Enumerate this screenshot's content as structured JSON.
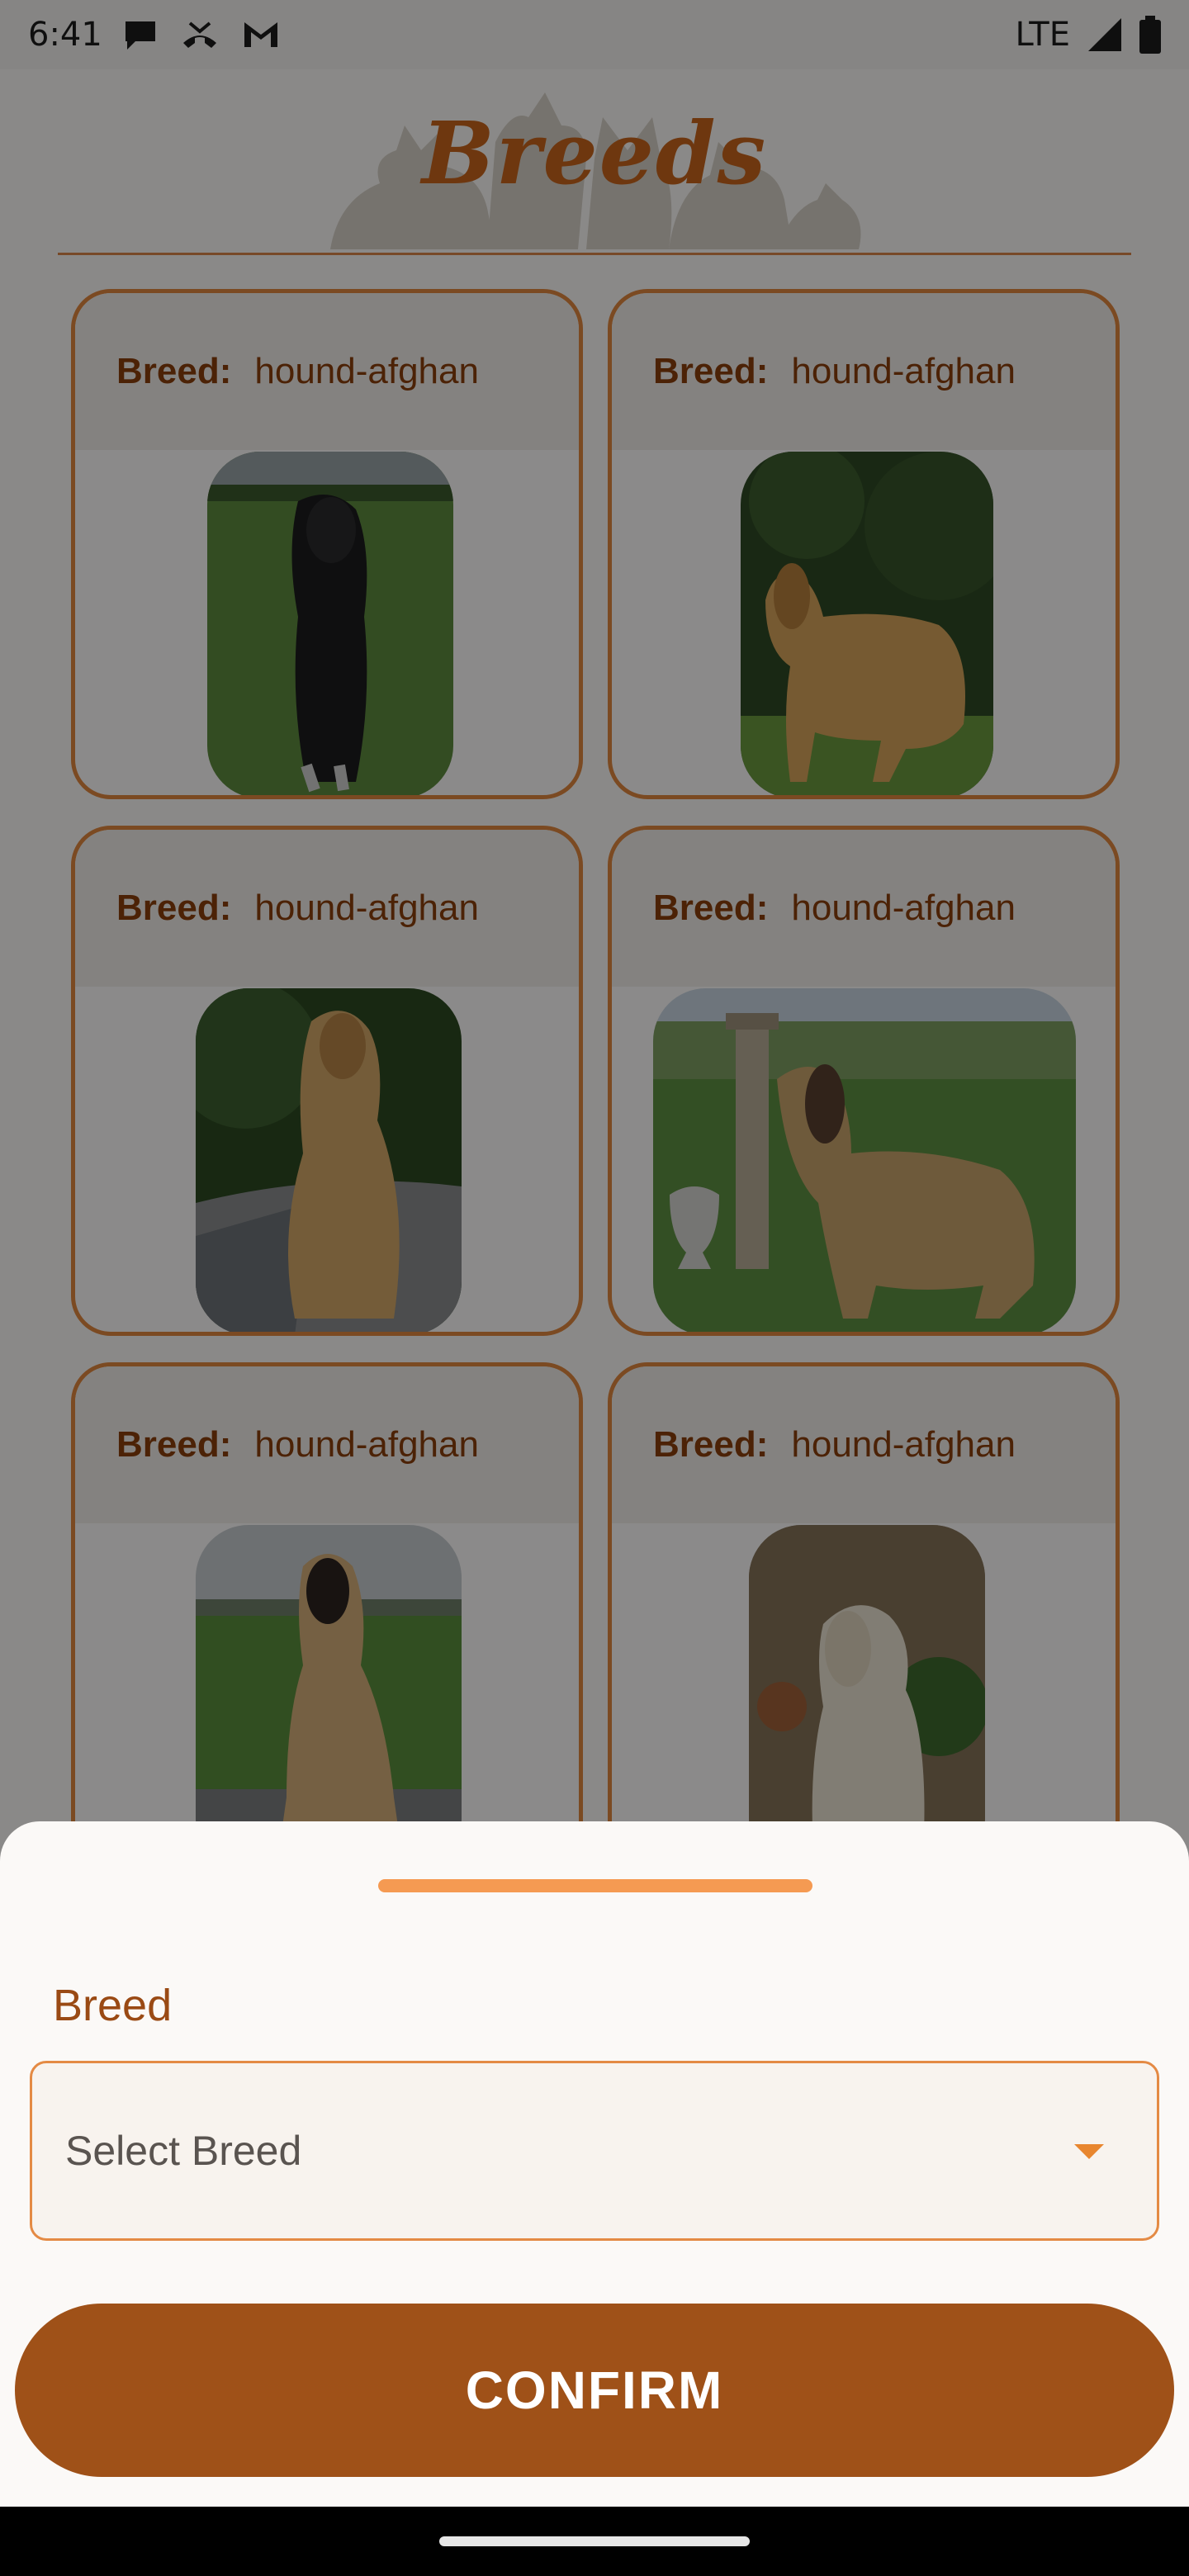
{
  "status_bar": {
    "time": "6:41",
    "network": "LTE",
    "icons": [
      "chat-bubble-icon",
      "missed-call-icon",
      "gmail-icon",
      "signal-icon",
      "battery-icon"
    ]
  },
  "header": {
    "title": "Breeds"
  },
  "cards": [
    {
      "label": "Breed:",
      "value": "hound-afghan",
      "photo": "dark-afghan-hound-photo"
    },
    {
      "label": "Breed:",
      "value": "hound-afghan",
      "photo": "golden-afghan-hound-photo"
    },
    {
      "label": "Breed:",
      "value": "hound-afghan",
      "photo": "cream-afghan-hound-path-photo"
    },
    {
      "label": "Breed:",
      "value": "hound-afghan",
      "photo": "afghan-hound-trophy-photo"
    },
    {
      "label": "Breed:",
      "value": "hound-afghan",
      "photo": "afghan-hound-field-photo"
    },
    {
      "label": "Breed:",
      "value": "hound-afghan",
      "photo": "afghan-hound-wall-photo"
    }
  ],
  "sheet": {
    "field_label": "Breed",
    "select_placeholder": "Select Breed",
    "confirm_label": "CONFIRM"
  },
  "colors": {
    "accent": "#e1873f",
    "brand_dark": "#9f5118",
    "label": "#8b3f0b"
  }
}
